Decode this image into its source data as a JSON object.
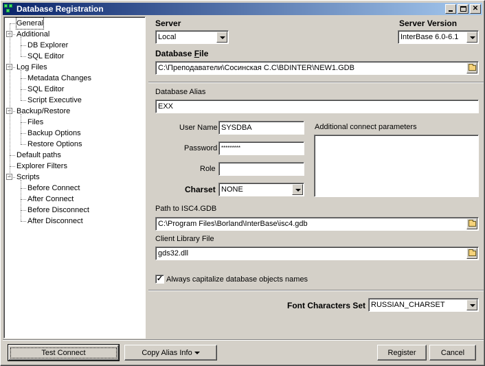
{
  "window": {
    "title": "Database Registration"
  },
  "tree": {
    "items": [
      {
        "label": "General",
        "level": 0,
        "selected": true,
        "expander": ""
      },
      {
        "label": "Additional",
        "level": 0,
        "expander": "−"
      },
      {
        "label": "DB Explorer",
        "level": 1
      },
      {
        "label": "SQL Editor",
        "level": 1
      },
      {
        "label": "Log Files",
        "level": 0,
        "expander": "−"
      },
      {
        "label": "Metadata Changes",
        "level": 1
      },
      {
        "label": "SQL Editor",
        "level": 1
      },
      {
        "label": "Script Executive",
        "level": 1
      },
      {
        "label": "Backup/Restore",
        "level": 0,
        "expander": "−"
      },
      {
        "label": "Files",
        "level": 1
      },
      {
        "label": "Backup Options",
        "level": 1
      },
      {
        "label": "Restore Options",
        "level": 1
      },
      {
        "label": "Default paths",
        "level": 0
      },
      {
        "label": "Explorer Filters",
        "level": 0
      },
      {
        "label": "Scripts",
        "level": 0,
        "expander": "−"
      },
      {
        "label": "Before Connect",
        "level": 1
      },
      {
        "label": "After Connect",
        "level": 1
      },
      {
        "label": "Before Disconnect",
        "level": 1
      },
      {
        "label": "After Disconnect",
        "level": 1
      }
    ]
  },
  "form": {
    "server_label": "Server",
    "server_value": "Local",
    "server_version_label": "Server Version",
    "server_version_value": "InterBase 6.0-6.1",
    "database_file_label_pre": "Database ",
    "database_file_label_ul": "F",
    "database_file_label_post": "ile",
    "database_file_value": "C:\\Преподаватели\\Сосинская С.С\\BDINTER\\NEW1.GDB",
    "alias_label": "Database Alias",
    "alias_value": "EXX",
    "username_label": "User Name",
    "username_value": "SYSDBA",
    "password_label": "Password",
    "password_value": "*********",
    "role_label": "Role",
    "role_value": "",
    "charset_label": "Charset",
    "charset_value": "NONE",
    "additional_params_label": "Additional connect parameters",
    "isc4_label": "Path to ISC4.GDB",
    "isc4_value": "C:\\Program Files\\Borland\\InterBase\\isc4.gdb",
    "client_lib_label": "Client Library File",
    "client_lib_value": "gds32.dll",
    "capitalize_label": "Always capitalize database objects names",
    "capitalize_checked": true,
    "font_charset_label": "Font Characters Set",
    "font_charset_value": "RUSSIAN_CHARSET"
  },
  "buttons": {
    "test_connect": "Test Connect",
    "copy_alias": "Copy Alias Info",
    "register": "Register",
    "cancel": "Cancel"
  }
}
